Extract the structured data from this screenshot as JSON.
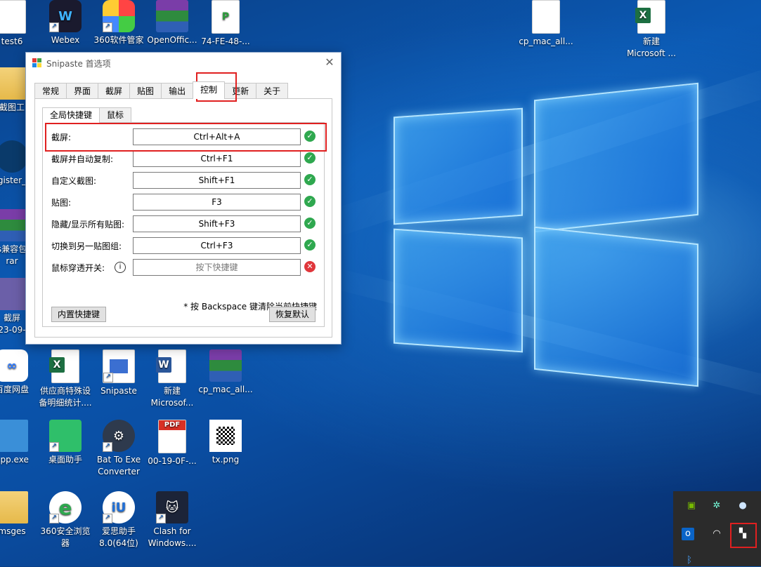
{
  "desktop_icons": [
    {
      "name": "test6",
      "label": "test6"
    },
    {
      "name": "webex",
      "label": "Webex"
    },
    {
      "name": "360-software",
      "label": "360软件管家"
    },
    {
      "name": "openoffice",
      "label": "OpenOffic..."
    },
    {
      "name": "74fe48",
      "label": "74-FE-48-..."
    },
    {
      "name": "cp-mac-all-top",
      "label": "cp_mac_all..."
    },
    {
      "name": "new-microsoft-excel",
      "label": "新建\nMicrosoft ..."
    },
    {
      "name": "capture-tool",
      "label": "截图工"
    },
    {
      "name": "register",
      "label": "gister_"
    },
    {
      "name": "compat-rar",
      "label": "s兼容包\nrar"
    },
    {
      "name": "screenshot-file",
      "label": "截屏\n23-09-"
    },
    {
      "name": "baidu-netdisk",
      "label": "百度网盘"
    },
    {
      "name": "supplier-excel",
      "label": "供应商特殊设\n备明细统计...."
    },
    {
      "name": "snipaste",
      "label": "Snipaste"
    },
    {
      "name": "new-microsoft-word",
      "label": "新建\nMicrosof..."
    },
    {
      "name": "cp-mac-all",
      "label": "cp_mac_all..."
    },
    {
      "name": "app-exe",
      "label": "app.exe"
    },
    {
      "name": "desktop-helper",
      "label": "桌面助手"
    },
    {
      "name": "bat-to-exe",
      "label": "Bat To Exe\nConverter"
    },
    {
      "name": "pdf-file",
      "label": "00-19-0F-..."
    },
    {
      "name": "tx-png",
      "label": "tx.png"
    },
    {
      "name": "msges",
      "label": "msges"
    },
    {
      "name": "360-browser",
      "label": "360安全浏览\n器"
    },
    {
      "name": "aisi-helper",
      "label": "爱思助手\n8.0(64位)"
    },
    {
      "name": "clash",
      "label": "Clash for\nWindows...."
    }
  ],
  "dialog": {
    "title": "Snipaste 首选项",
    "tabs": [
      "常规",
      "界面",
      "截屏",
      "贴图",
      "输出",
      "控制",
      "更新",
      "关于"
    ],
    "active_tab": "控制",
    "subtabs": [
      "全局快捷键",
      "鼠标"
    ],
    "active_subtab": "全局快捷键",
    "hotkeys": [
      {
        "label": "截屏:",
        "value": "Ctrl+Alt+A",
        "status": "ok"
      },
      {
        "label": "截屏并自动复制:",
        "value": "Ctrl+F1",
        "status": "ok"
      },
      {
        "label": "自定义截图:",
        "value": "Shift+F1",
        "status": "ok"
      },
      {
        "label": "贴图:",
        "value": "F3",
        "status": "ok"
      },
      {
        "label": "隐藏/显示所有贴图:",
        "value": "Shift+F3",
        "status": "ok"
      },
      {
        "label": "切换到另一贴图组:",
        "value": "Ctrl+F3",
        "status": "ok"
      },
      {
        "label": "鼠标穿透开关:",
        "placeholder": "按下快捷键",
        "status": "error"
      }
    ],
    "hint": "* 按 Backspace 键清除当前快捷键",
    "builtin_button": "内置快捷键",
    "restore_button": "恢复默认"
  },
  "colors": {
    "highlight": "#e02020",
    "ok": "#2fa84f",
    "error": "#e0363b"
  }
}
